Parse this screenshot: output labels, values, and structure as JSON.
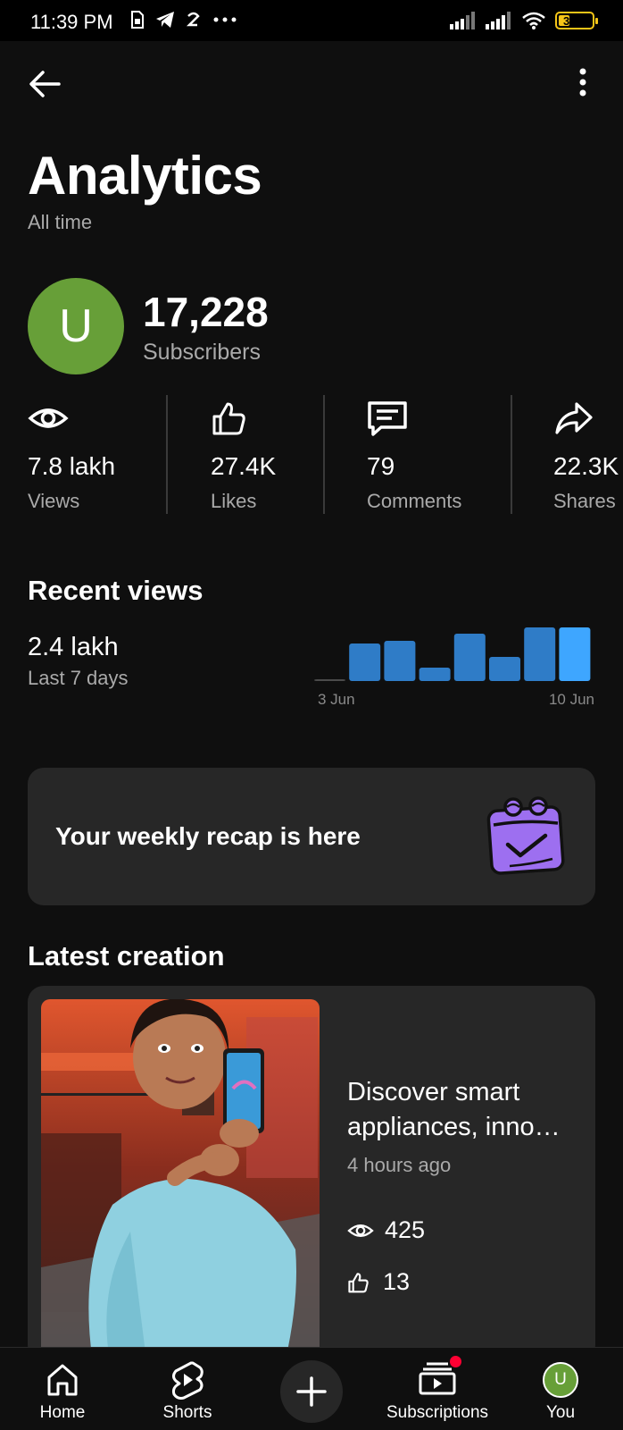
{
  "status_bar": {
    "time": "11:39 PM",
    "battery": "31"
  },
  "header": {
    "title": "Analytics",
    "period": "All time"
  },
  "channel": {
    "avatar_letter": "U",
    "subscribers_count": "17,228",
    "subscribers_label": "Subscribers"
  },
  "stats": [
    {
      "icon": "eye-icon",
      "value": "7.8 lakh",
      "label": "Views"
    },
    {
      "icon": "thumbs-up-icon",
      "value": "27.4K",
      "label": "Likes"
    },
    {
      "icon": "comment-icon",
      "value": "79",
      "label": "Comments"
    },
    {
      "icon": "share-icon",
      "value": "22.3K",
      "label": "Shares"
    }
  ],
  "recent_views": {
    "title": "Recent views",
    "value": "2.4 lakh",
    "period": "Last 7 days",
    "start_label": "3 Jun",
    "end_label": "10 Jun"
  },
  "chart_data": {
    "type": "bar",
    "categories": [
      "",
      "",
      "",
      "",
      "",
      "",
      "",
      ""
    ],
    "values": [
      2,
      42,
      45,
      15,
      53,
      27,
      60,
      60
    ],
    "x_tick_labels": [
      "3 Jun",
      "10 Jun"
    ],
    "ylim": [
      0,
      62
    ],
    "grid": false,
    "colors": [
      "#4b4b4b",
      "#2f7cc7",
      "#2f7cc7",
      "#2f7cc7",
      "#2f7cc7",
      "#2f7cc7",
      "#2f7cc7",
      "#3ea6ff"
    ]
  },
  "recap": {
    "text": "Your weekly recap is here",
    "icon": "calendar-check-icon"
  },
  "latest_creation": {
    "section_title": "Latest creation",
    "video_title": "Discover smart appliances, inno…",
    "time_ago": "4 hours ago",
    "views": "425",
    "likes": "13"
  },
  "bottom_nav": {
    "home": "Home",
    "shorts": "Shorts",
    "subscriptions": "Subscriptions",
    "you": "You",
    "you_avatar_letter": "U"
  },
  "colors": {
    "background": "#0f0f0f",
    "card": "#272727",
    "muted_text": "#aaaaaa",
    "avatar_green": "#679f38",
    "bar_blue": "#2f7cc7",
    "bar_highlight": "#3ea6ff",
    "notification_red": "#ff0033",
    "battery_yellow": "#f5c518"
  }
}
